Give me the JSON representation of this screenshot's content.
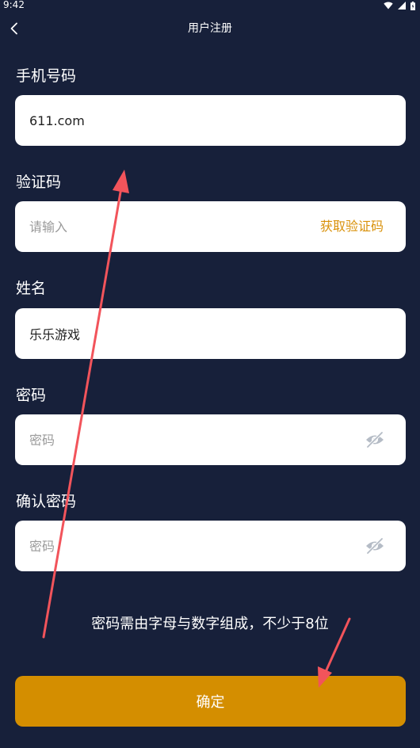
{
  "status_bar": {
    "time": "9:42"
  },
  "header": {
    "title": "用户注册",
    "back_icon": "chevron-left-icon"
  },
  "form": {
    "phone": {
      "label": "手机号码",
      "value": "611.com"
    },
    "code": {
      "label": "验证码",
      "placeholder": "请输入",
      "action_label": "获取验证码"
    },
    "name": {
      "label": "姓名",
      "value": "乐乐游戏"
    },
    "password": {
      "label": "密码",
      "placeholder": "密码",
      "toggle_icon": "eye-off-icon"
    },
    "confirm_password": {
      "label": "确认密码",
      "placeholder": "密码",
      "toggle_icon": "eye-off-icon"
    }
  },
  "hint": "密码需由字母与数字组成，不少于8位",
  "confirm_button": {
    "label": "确定"
  },
  "colors": {
    "background": "#17203a",
    "accent": "#d48e00",
    "link": "#d9910a",
    "annotation_arrow": "#f2545b"
  }
}
